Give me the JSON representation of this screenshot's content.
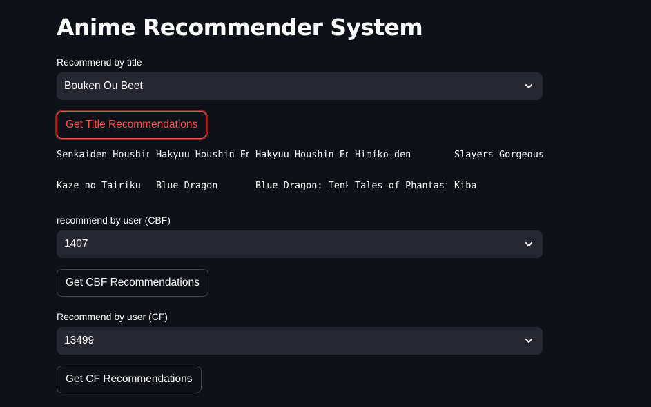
{
  "page": {
    "title": "Anime Recommender System"
  },
  "title_section": {
    "label": "Recommend by title",
    "selected": "Bouken Ou Beet",
    "button_label": "Get Title Recommendations",
    "results": [
      [
        "Senkaiden Houshin Engi",
        "Hakyuu Houshin Engi",
        "Hakyuu Houshin Engi",
        "Himiko-den",
        "Slayers Gorgeous"
      ],
      [
        "Kaze no Tairiku",
        "Blue Dragon",
        "Blue Dragon: Tenkai no Shichi Ryuu",
        "Tales of Phantasia",
        "Kiba"
      ]
    ]
  },
  "cbf_section": {
    "label": "recommend by user (CBF)",
    "selected": "1407",
    "button_label": "Get CBF Recommendations"
  },
  "cf_section": {
    "label": "Recommend by user (CF)",
    "selected": "13499",
    "button_label": "Get CF Recommendations"
  },
  "colors": {
    "background": "#0e1117",
    "select_background": "#262730",
    "accent": "#ff4b4b",
    "text": "#fafafa"
  },
  "icons": {
    "dropdown": "chevron-down-icon"
  }
}
